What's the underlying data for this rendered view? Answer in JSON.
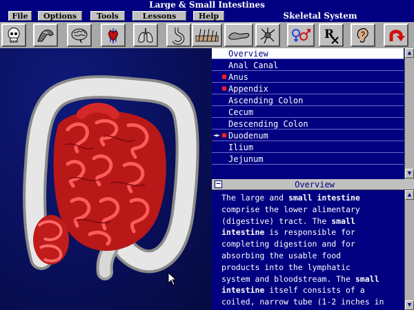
{
  "window": {
    "title": "Large & Small Intestines"
  },
  "menu": {
    "items": [
      "File",
      "Options",
      "Tools",
      "Lessons",
      "Help"
    ],
    "system_label": "Skeletal System"
  },
  "toolbar": {
    "tools": [
      {
        "icon": "skull-icon"
      },
      {
        "icon": "muscle-arm-icon"
      },
      {
        "icon": "brain-icon"
      },
      {
        "icon": "heart-vessels-icon"
      },
      {
        "icon": "lungs-icon"
      },
      {
        "icon": "stomach-icon"
      },
      {
        "icon": "skin-hair-icon"
      },
      {
        "icon": "pancreas-icon"
      },
      {
        "icon": "nerve-cell-icon"
      },
      {
        "icon": "gender-symbols-icon"
      },
      {
        "icon": "rx-icon"
      },
      {
        "icon": "ear-icon"
      },
      {
        "icon": "return-arrow-icon"
      }
    ]
  },
  "topics": {
    "items": [
      {
        "label": "Overview",
        "selected": true,
        "bullet": false,
        "arrow": false
      },
      {
        "label": "Anal Canal",
        "selected": false,
        "bullet": false,
        "arrow": false
      },
      {
        "label": "Anus",
        "selected": false,
        "bullet": true,
        "arrow": false
      },
      {
        "label": "Appendix",
        "selected": false,
        "bullet": true,
        "arrow": false
      },
      {
        "label": "Ascending Colon",
        "selected": false,
        "bullet": false,
        "arrow": false
      },
      {
        "label": "Cecum",
        "selected": false,
        "bullet": false,
        "arrow": false
      },
      {
        "label": "Descending Colon",
        "selected": false,
        "bullet": false,
        "arrow": false
      },
      {
        "label": "Duodenum",
        "selected": false,
        "bullet": true,
        "arrow": true
      },
      {
        "label": "Ilium",
        "selected": false,
        "bullet": false,
        "arrow": false
      },
      {
        "label": "Jejunum",
        "selected": false,
        "bullet": false,
        "arrow": false
      }
    ]
  },
  "description": {
    "title": "Overview",
    "lines": [
      [
        {
          "t": "The large and "
        },
        {
          "t": "small intestine",
          "b": true
        }
      ],
      [
        {
          "t": "comprise the lower alimentary"
        }
      ],
      [
        {
          "t": "(digestive) tract. The "
        },
        {
          "t": "small",
          "b": true
        }
      ],
      [
        {
          "t": "intestine",
          "b": true
        },
        {
          "t": " is responsible for"
        }
      ],
      [
        {
          "t": "completing digestion and for"
        }
      ],
      [
        {
          "t": "absorbing the usable food"
        }
      ],
      [
        {
          "t": "products into the lymphatic"
        }
      ],
      [
        {
          "t": "system and bloodstream. The "
        },
        {
          "t": "small",
          "b": true
        }
      ],
      [
        {
          "t": "intestine",
          "b": true
        },
        {
          "t": " itself consists of a"
        }
      ],
      [
        {
          "t": "coiled, narrow tube (1-2 inches in"
        }
      ]
    ]
  },
  "colors": {
    "panel_blue": "#000080",
    "selected_bg": "#ffffff",
    "bullet_red": "#ff2020",
    "button_gray": "#c0c0c0"
  }
}
